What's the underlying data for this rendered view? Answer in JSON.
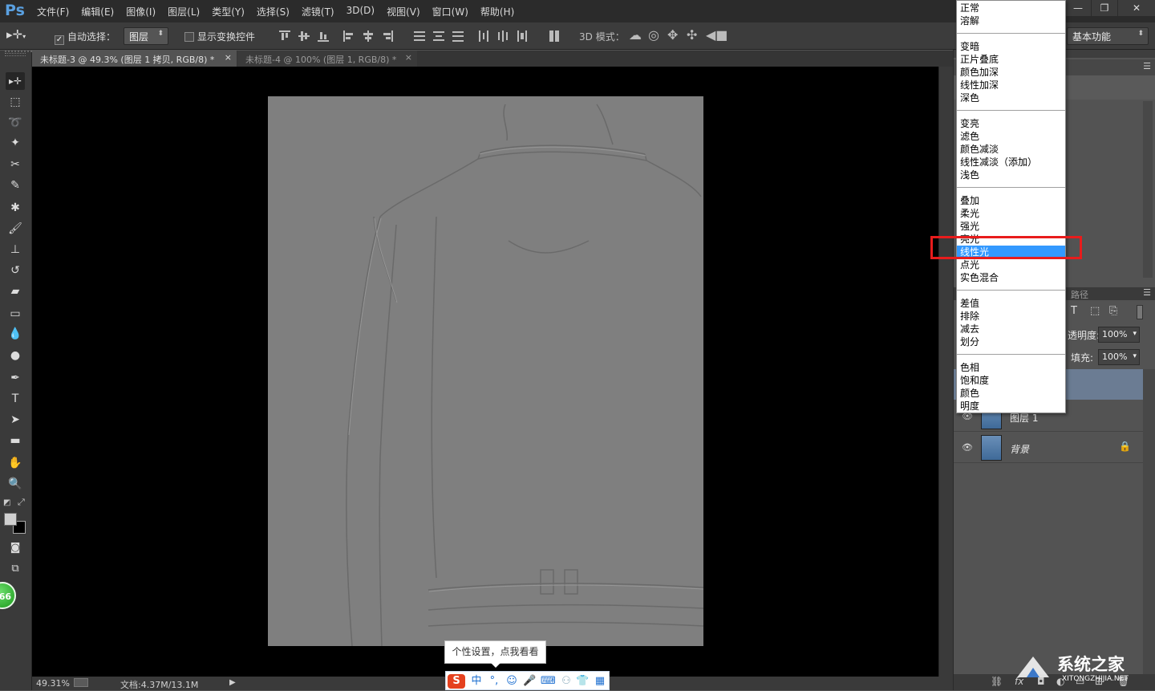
{
  "app": {
    "logo": "Ps",
    "menus": [
      "文件(F)",
      "编辑(E)",
      "图像(I)",
      "图层(L)",
      "类型(Y)",
      "选择(S)",
      "滤镜(T)",
      "3D(D)",
      "视图(V)",
      "窗口(W)",
      "帮助(H)"
    ],
    "window_controls": [
      "—",
      "❐",
      "✕"
    ]
  },
  "options_bar": {
    "auto_select_label": "自动选择：",
    "auto_select_checked": true,
    "auto_select_value": "图层",
    "show_transform_label": "显示变换控件",
    "mode_3d_label": "3D 模式：",
    "workspace_value": "基本功能"
  },
  "tabs": [
    {
      "label": "未标题-3 @ 49.3% (图层 1 拷贝, RGB/8) *",
      "close": "×",
      "active": true
    },
    {
      "label": "未标题-4 @ 100% (图层 1, RGB/8) *",
      "close": "×",
      "active": false
    }
  ],
  "toolbox": {
    "tools": [
      {
        "name": "move-tool-icon",
        "glyph": "▸✛"
      },
      {
        "name": "marquee-tool-icon",
        "glyph": "⬚"
      },
      {
        "name": "lasso-tool-icon",
        "glyph": "➰"
      },
      {
        "name": "magic-wand-tool-icon",
        "glyph": "✦"
      },
      {
        "name": "crop-tool-icon",
        "glyph": "✂"
      },
      {
        "name": "eyedropper-tool-icon",
        "glyph": "✎"
      },
      {
        "name": "healing-brush-tool-icon",
        "glyph": "✱"
      },
      {
        "name": "brush-tool-icon",
        "glyph": "🖌"
      },
      {
        "name": "clone-stamp-tool-icon",
        "glyph": "⊥"
      },
      {
        "name": "history-brush-tool-icon",
        "glyph": "↺"
      },
      {
        "name": "eraser-tool-icon",
        "glyph": "▰"
      },
      {
        "name": "gradient-tool-icon",
        "glyph": "▭"
      },
      {
        "name": "blur-tool-icon",
        "glyph": "💧"
      },
      {
        "name": "dodge-tool-icon",
        "glyph": "●"
      },
      {
        "name": "pen-tool-icon",
        "glyph": "✒"
      },
      {
        "name": "type-tool-icon",
        "glyph": "T"
      },
      {
        "name": "path-selection-tool-icon",
        "glyph": "➤"
      },
      {
        "name": "shape-tool-icon",
        "glyph": "▬"
      },
      {
        "name": "hand-tool-icon",
        "glyph": "✋"
      },
      {
        "name": "zoom-tool-icon",
        "glyph": "🔍"
      }
    ],
    "badge_text": "66"
  },
  "status": {
    "zoom": "49.31%",
    "doc_size": "文档:4.37M/13.1M"
  },
  "blend_mode_dropdown": {
    "groups": [
      [
        "正常",
        "溶解"
      ],
      [
        "变暗",
        "正片叠底",
        "颜色加深",
        "线性加深",
        "深色"
      ],
      [
        "变亮",
        "滤色",
        "颜色减淡",
        "线性减淡（添加）",
        "浅色"
      ],
      [
        "叠加",
        "柔光",
        "强光",
        "亮光",
        "线性光",
        "点光",
        "实色混合"
      ],
      [
        "差值",
        "排除",
        "减去",
        "划分"
      ],
      [
        "色相",
        "饱和度",
        "颜色",
        "明度"
      ]
    ],
    "selected": "线性光",
    "highlight_color": "#e81c1c"
  },
  "layers_panel": {
    "paths_tab": "路径",
    "opacity_label": "透明度:",
    "opacity_value": "100%",
    "fill_label": "填充:",
    "fill_value": "100%",
    "layers": [
      {
        "name": "图层 1",
        "italic": false
      },
      {
        "name": "背景",
        "italic": true
      }
    ]
  },
  "ime": {
    "tooltip": "个性设置，点我看看",
    "items": [
      "S",
      "中",
      "°,",
      "☺",
      "🎤",
      "⌨",
      "👕"
    ]
  },
  "watermark": {
    "text": "系统之家",
    "url": "XITONGZHIJIA.NET"
  }
}
